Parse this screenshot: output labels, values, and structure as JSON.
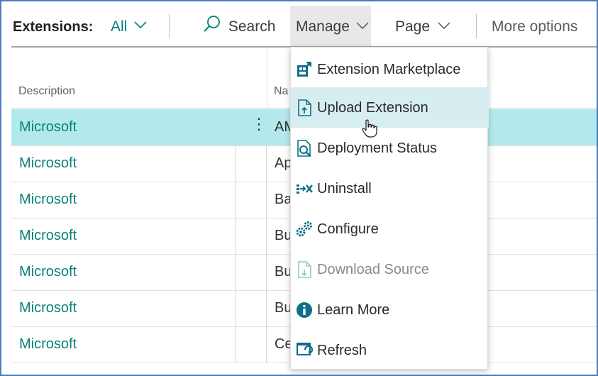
{
  "action_bar": {
    "title": "Extensions:",
    "filter": "All",
    "search_label": "Search",
    "manage_label": "Manage",
    "page_label": "Page",
    "more_label": "More options"
  },
  "columns": {
    "description": "Description",
    "name": "Na"
  },
  "rows": [
    {
      "publisher": "Microsoft",
      "name": "AM",
      "selected": true
    },
    {
      "publisher": "Microsoft",
      "name": "Ap"
    },
    {
      "publisher": "Microsoft",
      "name": "Ba"
    },
    {
      "publisher": "Microsoft",
      "name": "Bu"
    },
    {
      "publisher": "Microsoft",
      "name": "Bu"
    },
    {
      "publisher": "Microsoft",
      "name": "Bu"
    },
    {
      "publisher": "Microsoft",
      "name": "Ce"
    }
  ],
  "manage_menu": {
    "items": [
      {
        "label": "Extension Marketplace",
        "icon": "marketplace-icon"
      },
      {
        "label": "Upload Extension",
        "icon": "upload-icon",
        "hovered": true
      },
      {
        "label": "Deployment Status",
        "icon": "deployment-status-icon"
      },
      {
        "label": "Uninstall",
        "icon": "uninstall-icon"
      },
      {
        "label": "Configure",
        "icon": "configure-icon"
      },
      {
        "label": "Download Source",
        "icon": "download-source-icon",
        "disabled": true
      },
      {
        "label": "Learn More",
        "icon": "info-icon"
      },
      {
        "label": "Refresh",
        "icon": "refresh-icon"
      }
    ]
  },
  "colors": {
    "accent": "#00807a",
    "selected_row": "#b3e9ec",
    "hover_item": "#d6eef0",
    "frame": "#4a7dbf"
  }
}
